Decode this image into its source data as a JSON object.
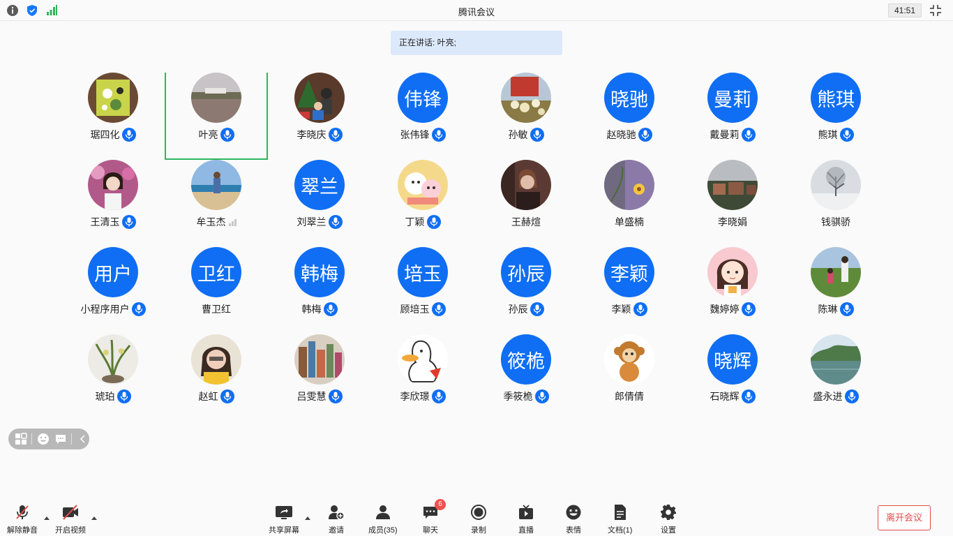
{
  "window": {
    "title": "腾讯会议",
    "timer": "41:51"
  },
  "header_icons": [
    "info-icon",
    "shield-icon",
    "network-signal-icon"
  ],
  "speaking": {
    "label": "正在讲话: 叶亮;"
  },
  "colors": {
    "accent": "#0f6ef3",
    "active_border": "#2db55d",
    "leave": "#e04b4b",
    "badge": "#f0504d"
  },
  "participants": [
    {
      "name": "琚四化",
      "avatar_text": "",
      "avatar_type": "photo",
      "photo": "painting",
      "status": "mic"
    },
    {
      "name": "叶亮",
      "avatar_text": "",
      "avatar_type": "photo",
      "photo": "landscape-lake",
      "status": "mic",
      "active": true
    },
    {
      "name": "李晓庆",
      "avatar_text": "",
      "avatar_type": "photo",
      "photo": "christmas",
      "status": "mic"
    },
    {
      "name": "张伟锋",
      "avatar_text": "伟锋",
      "avatar_type": "text",
      "status": "mic"
    },
    {
      "name": "孙敏",
      "avatar_text": "",
      "avatar_type": "photo",
      "photo": "flowers",
      "status": "mic"
    },
    {
      "name": "赵晓驰",
      "avatar_text": "晓驰",
      "avatar_type": "text",
      "status": "mic"
    },
    {
      "name": "戴曼莉",
      "avatar_text": "曼莉",
      "avatar_type": "text",
      "status": "mic"
    },
    {
      "name": "熊琪",
      "avatar_text": "熊琪",
      "avatar_type": "text",
      "status": "mic"
    },
    {
      "name": "王清玉",
      "avatar_text": "",
      "avatar_type": "photo",
      "photo": "woman-flowers",
      "status": "mic"
    },
    {
      "name": "牟玉杰",
      "avatar_text": "",
      "avatar_type": "photo",
      "photo": "beach",
      "status": "signal"
    },
    {
      "name": "刘翠兰",
      "avatar_text": "翠兰",
      "avatar_type": "text",
      "status": "mic"
    },
    {
      "name": "丁颖",
      "avatar_text": "",
      "avatar_type": "photo",
      "photo": "cartoon-cats",
      "status": "mic"
    },
    {
      "name": "王赫煊",
      "avatar_text": "",
      "avatar_type": "photo",
      "photo": "dark-portrait",
      "status": "none"
    },
    {
      "name": "单盛楠",
      "avatar_text": "",
      "avatar_type": "photo",
      "photo": "purple-flower",
      "status": "none"
    },
    {
      "name": "李晓娟",
      "avatar_text": "",
      "avatar_type": "photo",
      "photo": "buildings",
      "status": "none"
    },
    {
      "name": "钱骐骄",
      "avatar_text": "",
      "avatar_type": "photo",
      "photo": "snow-tree",
      "status": "none"
    },
    {
      "name": "小程序用户",
      "avatar_text": "用户",
      "avatar_type": "text",
      "status": "mic"
    },
    {
      "name": "曹卫红",
      "avatar_text": "卫红",
      "avatar_type": "text",
      "status": "none"
    },
    {
      "name": "韩梅",
      "avatar_text": "韩梅",
      "avatar_type": "text",
      "status": "mic"
    },
    {
      "name": "顾培玉",
      "avatar_text": "培玉",
      "avatar_type": "text",
      "status": "mic"
    },
    {
      "name": "孙辰",
      "avatar_text": "孙辰",
      "avatar_type": "text",
      "status": "mic"
    },
    {
      "name": "李颖",
      "avatar_text": "李颖",
      "avatar_type": "text",
      "status": "mic"
    },
    {
      "name": "魏婷婷",
      "avatar_text": "",
      "avatar_type": "photo",
      "photo": "cartoon-girl",
      "status": "mic"
    },
    {
      "name": "陈琳",
      "avatar_text": "",
      "avatar_type": "photo",
      "photo": "field",
      "status": "mic"
    },
    {
      "name": "琥珀",
      "avatar_text": "",
      "avatar_type": "photo",
      "photo": "orchid",
      "status": "mic"
    },
    {
      "name": "赵虹",
      "avatar_text": "",
      "avatar_type": "photo",
      "photo": "woman-yellow",
      "status": "mic"
    },
    {
      "name": "吕雯慧",
      "avatar_text": "",
      "avatar_type": "photo",
      "photo": "city-drawing",
      "status": "mic"
    },
    {
      "name": "李欣璟",
      "avatar_text": "",
      "avatar_type": "photo",
      "photo": "duck",
      "status": "mic"
    },
    {
      "name": "季筱桅",
      "avatar_text": "筱桅",
      "avatar_type": "text",
      "status": "mic"
    },
    {
      "name": "郎倩倩",
      "avatar_text": "",
      "avatar_type": "photo",
      "photo": "monkey",
      "status": "none"
    },
    {
      "name": "石晓辉",
      "avatar_text": "晓辉",
      "avatar_type": "text",
      "status": "mic"
    },
    {
      "name": "盛永进",
      "avatar_text": "",
      "avatar_type": "photo",
      "photo": "river",
      "status": "mic"
    }
  ],
  "float_bar": [
    "grid-view-icon",
    "emoji-icon",
    "chat-icon",
    "collapse-icon"
  ],
  "toolbar": {
    "unmute": "解除静音",
    "start_video": "开启视频",
    "share_screen": "共享屏幕",
    "invite": "邀请",
    "members": "成员(35)",
    "chat": "聊天",
    "chat_badge": "6",
    "record": "录制",
    "live": "直播",
    "reactions": "表情",
    "docs": "文档(1)",
    "settings": "设置",
    "leave": "离开会议"
  }
}
